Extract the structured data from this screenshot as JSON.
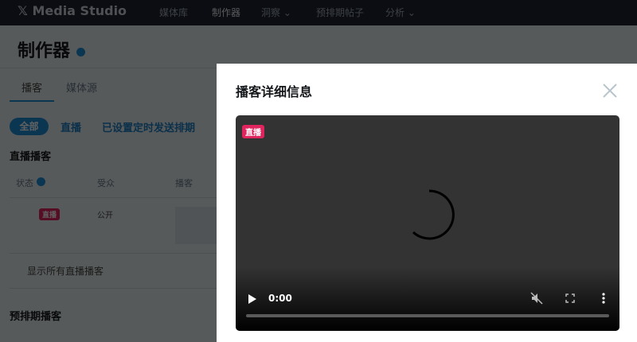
{
  "header": {
    "logo": "Media Studio",
    "nav": [
      {
        "label": "媒体库"
      },
      {
        "label": "制作器",
        "active": true
      },
      {
        "label": "洞察 ⌄"
      },
      {
        "label": "预排期帖子"
      },
      {
        "label": "分析 ⌄"
      }
    ]
  },
  "page": {
    "title": "制作器",
    "tabs": [
      "播客",
      "媒体源"
    ],
    "filters": [
      "全部",
      "直播",
      "已设置定时发送排期"
    ],
    "live_section": "直播播客",
    "columns": [
      "状态",
      "受众",
      "播客"
    ],
    "row": {
      "status": "直播",
      "audience": "公开"
    },
    "show_all": "显示所有直播播客",
    "scheduled_section": "预排期播客"
  },
  "modal": {
    "title": "播客详细信息",
    "live_badge": "直播",
    "time": "0:00",
    "progress": 0
  },
  "colors": {
    "accent": "#1d8fd8",
    "live": "#e0245e"
  }
}
